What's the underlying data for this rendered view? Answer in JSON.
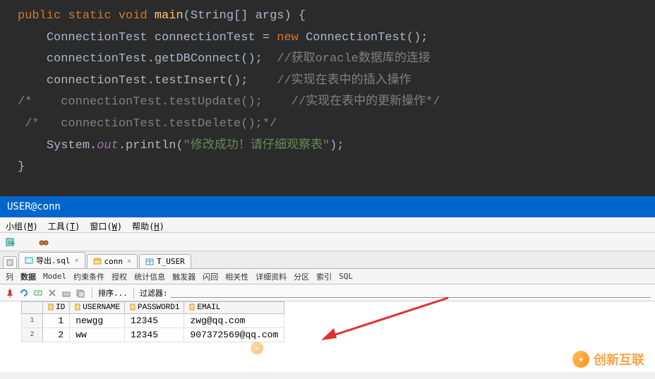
{
  "code": {
    "lines": [
      {
        "indent": "",
        "parts": [
          {
            "t": "public ",
            "c": "kw"
          },
          {
            "t": "static ",
            "c": "kw"
          },
          {
            "t": "void ",
            "c": "kw"
          },
          {
            "t": "main",
            "c": "method-def"
          },
          {
            "t": "(String[] args) {",
            "c": "ident"
          }
        ]
      },
      {
        "indent": "    ",
        "parts": [
          {
            "t": "ConnectionTest connectionTest = ",
            "c": "ident"
          },
          {
            "t": "new ",
            "c": "kw"
          },
          {
            "t": "ConnectionTest();",
            "c": "ident"
          }
        ]
      },
      {
        "indent": "    ",
        "parts": [
          {
            "t": "connectionTest.getDBConnect();  ",
            "c": "ident"
          },
          {
            "t": "//获取oracle数据库的连接",
            "c": "comment"
          }
        ]
      },
      {
        "indent": "    ",
        "parts": [
          {
            "t": "connectionTest.testInsert();    ",
            "c": "ident"
          },
          {
            "t": "//实现在表中的插入操作",
            "c": "comment"
          }
        ]
      },
      {
        "indent": "",
        "parts": [
          {
            "t": "/*    connectionTest.testUpdate();    //实现在表中的更新操作*/",
            "c": "comment"
          }
        ]
      },
      {
        "indent": "",
        "parts": [
          {
            "t": " /*   connectionTest.testDelete();*/",
            "c": "comment"
          }
        ]
      },
      {
        "indent": "    ",
        "parts": [
          {
            "t": "System.",
            "c": "ident"
          },
          {
            "t": "out",
            "c": "field"
          },
          {
            "t": ".println(",
            "c": "ident"
          },
          {
            "t": "\"修改成功！请仔细观察表\"",
            "c": "string"
          },
          {
            "t": ");",
            "c": "ident"
          }
        ]
      },
      {
        "indent": "",
        "parts": [
          {
            "t": "}",
            "c": "ident"
          }
        ]
      }
    ]
  },
  "title_bar": "USER@conn",
  "menu": {
    "items": [
      {
        "label": "小组",
        "key": "M"
      },
      {
        "label": "工具",
        "key": "T"
      },
      {
        "label": "窗口",
        "key": "W"
      },
      {
        "label": "帮助",
        "key": "H"
      }
    ]
  },
  "tabs": {
    "items": [
      {
        "label": "导出.sql",
        "icon": "sql-icon",
        "closeable": true
      },
      {
        "label": "conn",
        "icon": "db-icon",
        "closeable": true
      },
      {
        "label": "T_USER",
        "icon": "table-icon",
        "closeable": false
      }
    ]
  },
  "sub_tabs": {
    "items": [
      "列",
      "数据",
      "Model",
      "约束条件",
      "授权",
      "统计信息",
      "触发器",
      "闪回",
      "相关性",
      "详细资料",
      "分区",
      "索引",
      "SQL"
    ],
    "active": "数据"
  },
  "data_toolbar": {
    "sort_label": "排序...",
    "filter_label": "过滤器:",
    "filter_value": ""
  },
  "table": {
    "columns": [
      "ID",
      "USERNAME",
      "PASSWORD1",
      "EMAIL"
    ],
    "rows": [
      {
        "num": "1",
        "cells": [
          "1",
          "newgg",
          "12345",
          "zwg@qq.com"
        ]
      },
      {
        "num": "2",
        "cells": [
          "2",
          "ww",
          "12345",
          "907372569@qq.com"
        ]
      }
    ]
  },
  "watermark": "创新互联"
}
